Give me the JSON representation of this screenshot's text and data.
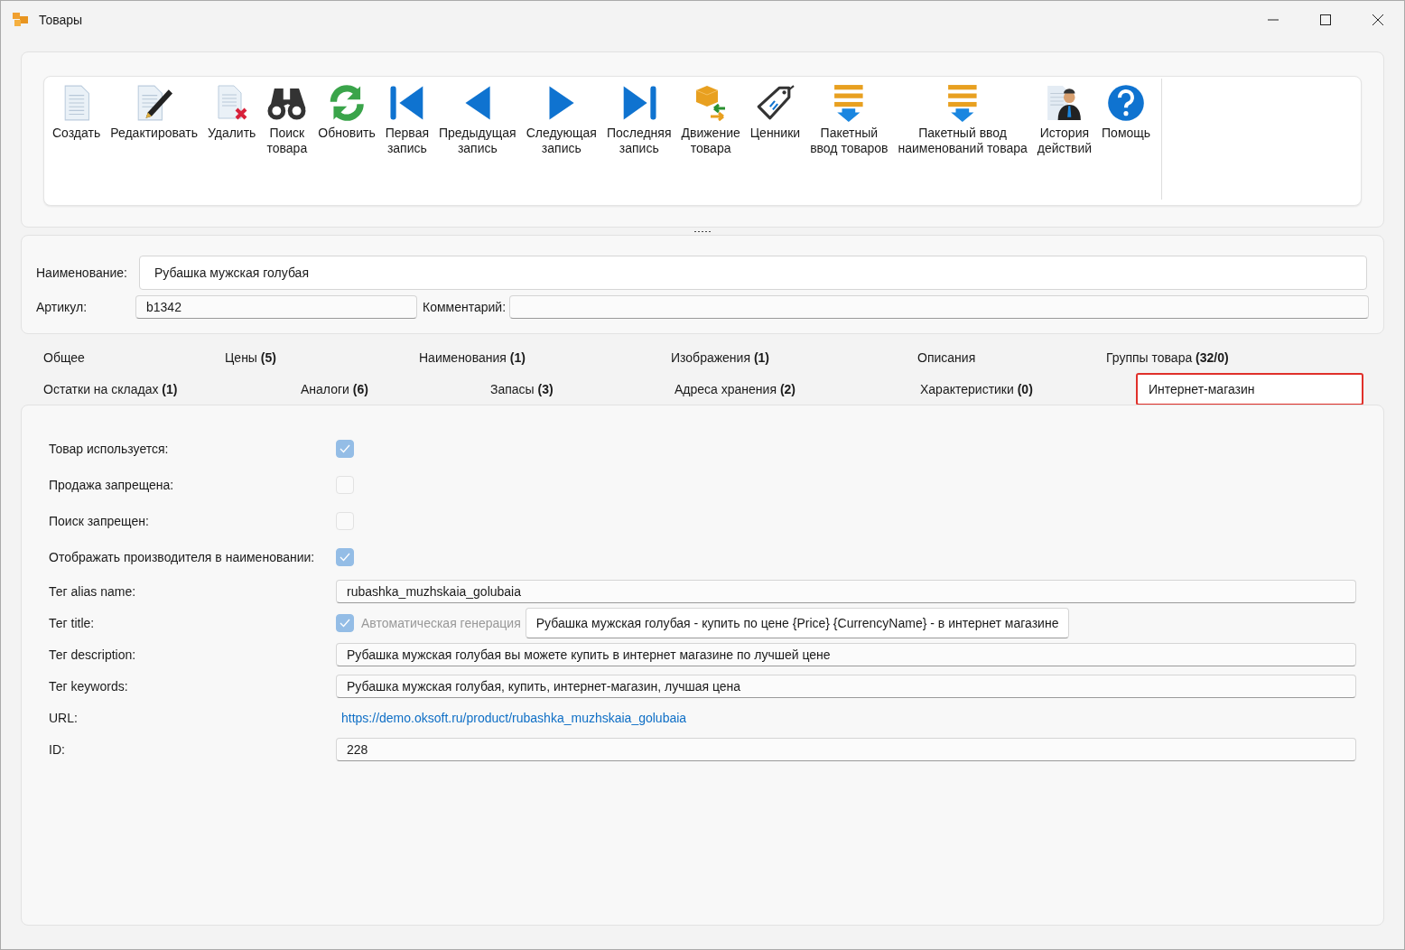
{
  "window": {
    "title": "Товары"
  },
  "toolbar": [
    {
      "lines": [
        "Создать"
      ]
    },
    {
      "lines": [
        "Редактировать"
      ]
    },
    {
      "lines": [
        "Удалить"
      ]
    },
    {
      "lines": [
        "Поиск",
        "товара"
      ]
    },
    {
      "lines": [
        "Обновить"
      ]
    },
    {
      "lines": [
        "Первая",
        "запись"
      ]
    },
    {
      "lines": [
        "Предыдущая",
        "запись"
      ]
    },
    {
      "lines": [
        "Следующая",
        "запись"
      ]
    },
    {
      "lines": [
        "Последняя",
        "запись"
      ]
    },
    {
      "lines": [
        "Движение",
        "товара"
      ]
    },
    {
      "lines": [
        "Ценники"
      ]
    },
    {
      "lines": [
        "Пакетный",
        "ввод товаров"
      ]
    },
    {
      "lines": [
        "Пакетный ввод",
        "наименований товара"
      ]
    },
    {
      "lines": [
        "История",
        "действий"
      ]
    },
    {
      "lines": [
        "Помощь"
      ]
    }
  ],
  "header": {
    "name_label": "Наименование:",
    "name_value": "Рубашка мужская голубая",
    "sku_label": "Артикул:",
    "sku_value": "b1342",
    "comment_label": "Комментарий:"
  },
  "tabs": [
    [
      {
        "label": "Общее",
        "selected": false
      },
      {
        "label": "Цены **(5)**",
        "selected": false
      },
      {
        "label": "Наименования **(1)**",
        "selected": false
      },
      {
        "label": "Изображения **(1)**",
        "selected": false
      },
      {
        "label": "Описания",
        "selected": false
      },
      {
        "label": "Группы товара **(32/0)**",
        "selected": false
      }
    ],
    [
      {
        "label": "Остатки на складах **(1)**",
        "selected": false
      },
      {
        "label": "Аналоги **(6)**",
        "selected": false
      },
      {
        "label": "Запасы **(3)**",
        "selected": false
      },
      {
        "label": "Адреса хранения **(2)**",
        "selected": false
      },
      {
        "label": "Характеристики **(0)**",
        "selected": false
      },
      {
        "label": "Интернет-магазин",
        "selected": true
      }
    ]
  ],
  "form": [
    {
      "kind": "checkbox",
      "label": "Товар используется:",
      "checked": true
    },
    {
      "kind": "checkbox",
      "label": "Продажа запрещена:",
      "checked": false
    },
    {
      "kind": "checkbox",
      "label": "Поиск запрещен:",
      "checked": false
    },
    {
      "kind": "checkbox",
      "label": "Отображать производителя в наименовании:",
      "checked": true
    },
    {
      "kind": "field",
      "label": "Тег alias name:",
      "value": "rubashka_muzhskaia_golubaia"
    },
    {
      "kind": "auto",
      "label": "Тег title:",
      "checked": true,
      "auto_label": "Автоматическая генерация",
      "value": "Рубашка мужская голубая - купить по цене  {Price} {CurrencyName} - в интернет магазине"
    },
    {
      "kind": "field",
      "label": "Тег description:",
      "value": "Рубашка мужская голубая вы можете купить в интернет магазине по лучшей цене"
    },
    {
      "kind": "field",
      "label": "Тег keywords:",
      "value": "Рубашка мужская голубая, купить, интернет-магазин, лучшая цена"
    },
    {
      "kind": "link",
      "label": "URL:",
      "value": "https://demo.oksoft.ru/product/rubashka_muzhskaia_golubaia"
    },
    {
      "kind": "field",
      "label": "ID:",
      "value": "228"
    }
  ]
}
